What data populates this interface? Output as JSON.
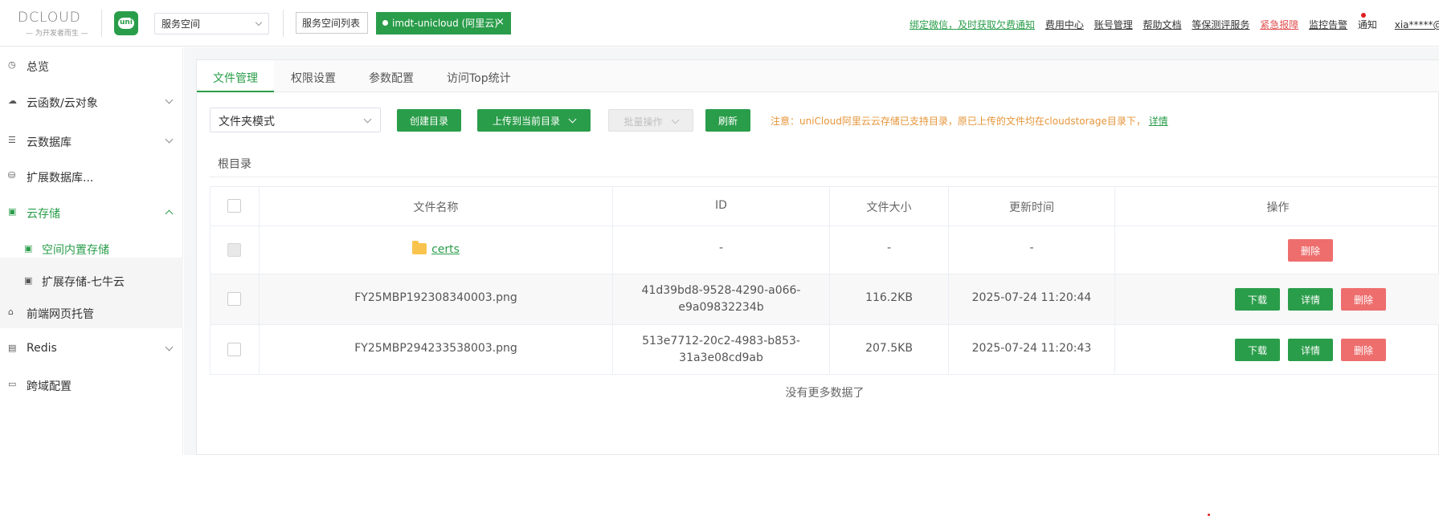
{
  "header": {
    "logo_text": "DCLOUD",
    "logo_sub": "— 为开发者而生 —",
    "uni_badge": "uni",
    "space_select": "服务空间",
    "space_list_button": "服务空间列表",
    "active_space": "imdt-unicloud (阿里云)",
    "active_close": "×",
    "links": [
      {
        "label": "绑定微信，及时获取欠费通知",
        "style": "green"
      },
      {
        "label": "费用中心",
        "style": "normal"
      },
      {
        "label": "账号管理",
        "style": "normal"
      },
      {
        "label": "帮助文档",
        "style": "normal"
      },
      {
        "label": "等保测评服务",
        "style": "normal"
      },
      {
        "label": "紧急报障",
        "style": "red"
      },
      {
        "label": "监控告警",
        "style": "normal"
      }
    ],
    "notify": "通知",
    "user": "xia*****@inno"
  },
  "sidebar": {
    "items": [
      {
        "label": "总览",
        "icon": "clock-icon",
        "glyph": "◷"
      },
      {
        "label": "云函数/云对象",
        "icon": "cloud-icon",
        "glyph": "☁"
      },
      {
        "label": "云数据库",
        "icon": "list-icon",
        "glyph": "☰"
      },
      {
        "label": "扩展数据库...",
        "icon": "database-icon",
        "glyph": "⛁"
      },
      {
        "label": "云存储",
        "icon": "storage-icon",
        "glyph": "▣"
      },
      {
        "label": "前端网页托管",
        "icon": "web-icon",
        "glyph": "⌂"
      },
      {
        "label": "Redis",
        "icon": "redis-icon",
        "glyph": "▤"
      },
      {
        "label": "跨域配置",
        "icon": "cors-icon",
        "glyph": "▭"
      }
    ],
    "sub_items": [
      {
        "label": "空间内置存储",
        "glyph": "▣"
      },
      {
        "label": "扩展存储-七牛云",
        "glyph": "▣"
      }
    ]
  },
  "main": {
    "tabs": [
      {
        "label": "文件管理"
      },
      {
        "label": "权限设置"
      },
      {
        "label": "参数配置"
      },
      {
        "label": "访问Top统计"
      }
    ],
    "mode_select": "文件夹模式",
    "buttons": {
      "create_dir": "创建目录",
      "upload": "上传到当前目录",
      "batch": "批量操作",
      "refresh": "刷新"
    },
    "notice": "注意：uniCloud阿里云云存储已支持目录，原已上传的文件均在cloudstorage目录下，",
    "notice_link": "详情",
    "breadcrumb": "根目录",
    "table": {
      "headers": [
        "文件名称",
        "ID",
        "文件大小",
        "更新时间",
        "操作"
      ],
      "rows": [
        {
          "name": "certs",
          "id": "-",
          "size": "-",
          "time": "-",
          "is_folder": true
        },
        {
          "name": "FY25MBP192308340003.png",
          "id": "41d39bd8-9528-4290-a066-e9a09832234b",
          "id_line1": "41d39bd8-9528-4290-a066-",
          "id_line2": "e9a09832234b",
          "size": "116.2KB",
          "time": "2025-07-24 11:20:44",
          "is_folder": false
        },
        {
          "name": "FY25MBP294233538003.png",
          "id": "513e7712-20c2-4983-b853-31a3e08cd9ab",
          "id_line1": "513e7712-20c2-4983-b853-",
          "id_line2": "31a3e08cd9ab",
          "size": "207.5KB",
          "time": "2025-07-24 11:20:43",
          "is_folder": false
        }
      ],
      "actions": {
        "download": "下载",
        "detail": "详情",
        "delete": "删除"
      }
    },
    "no_more": "没有更多数据了"
  },
  "colors": {
    "accent": "#2a9d4a",
    "danger": "#ee6e6e",
    "warning": "#e6953a"
  }
}
